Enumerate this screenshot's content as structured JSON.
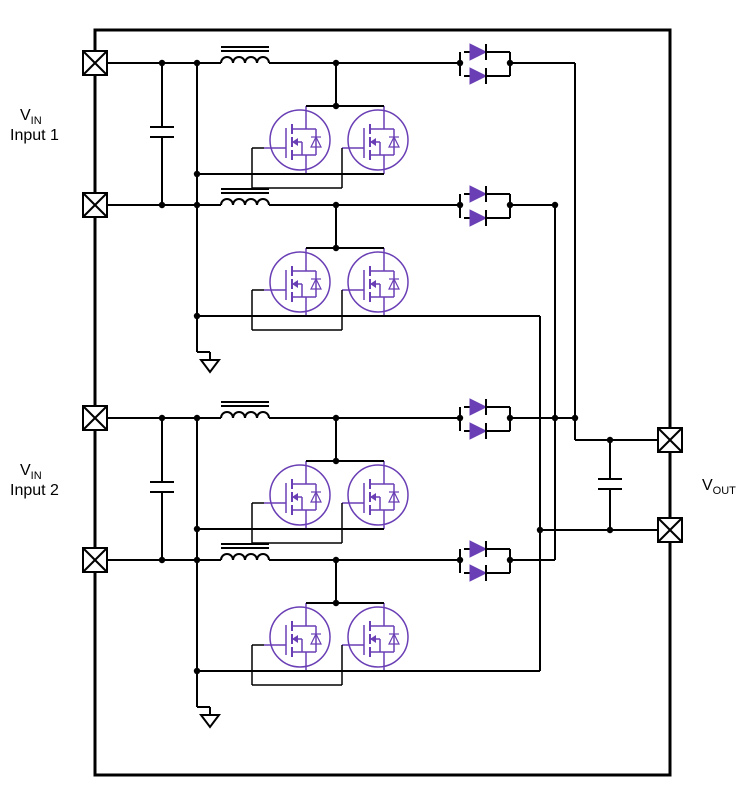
{
  "labels": {
    "vin1_line1": "V",
    "vin1_sub": "IN",
    "vin1_line2": "Input 1",
    "vin2_line1": "V",
    "vin2_sub": "IN",
    "vin2_line2": "Input 2",
    "vout": "V",
    "vout_sub": "OUT"
  },
  "colors": {
    "wire": "#000000",
    "accent": "#6a3fb5",
    "fill": "#ffffff"
  },
  "chart_data": {
    "type": "diagram",
    "description": "Dual-input interleaved boost converter block",
    "inputs": [
      {
        "name": "V_IN Input 1",
        "terminals": 2
      },
      {
        "name": "V_IN Input 2",
        "terminals": 2
      }
    ],
    "outputs": [
      {
        "name": "V_OUT",
        "terminals": 2
      }
    ],
    "per_input_channel": {
      "phases": 2,
      "input_capacitors": 1,
      "per_phase": {
        "inductors": 1,
        "mosfets_parallel": 2,
        "output_diodes": 2
      },
      "ground_reference": true
    },
    "output_stage": {
      "capacitors": 1
    },
    "component_totals": {
      "terminals": 6,
      "inductors": 4,
      "mosfets": 8,
      "diodes": 8,
      "capacitors_input": 2,
      "capacitors_output": 1,
      "ground_symbols": 2
    }
  }
}
